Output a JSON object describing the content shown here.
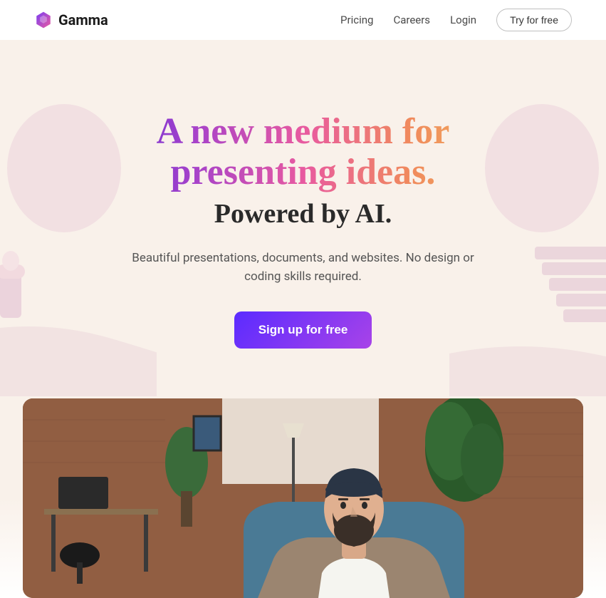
{
  "header": {
    "brand": "Gamma",
    "nav": {
      "pricing": "Pricing",
      "careers": "Careers",
      "login": "Login"
    },
    "try_label": "Try for free"
  },
  "hero": {
    "title": "A new medium for presenting ideas.",
    "subtitle": "Powered by AI.",
    "description": "Beautiful presentations, documents, and websites. No design or coding skills required.",
    "cta_label": "Sign up for free"
  }
}
